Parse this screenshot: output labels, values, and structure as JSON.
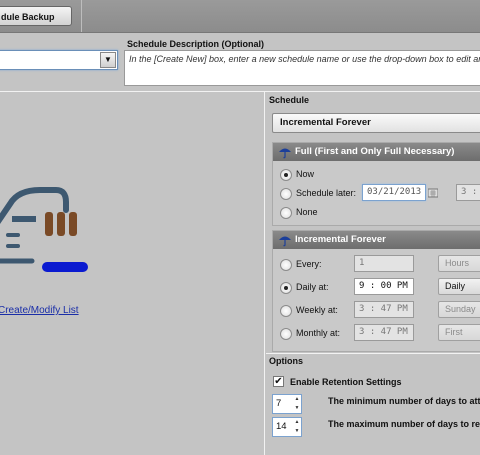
{
  "toolbar": {
    "tab_label": "dule Backup"
  },
  "schedule_name": {
    "value": ""
  },
  "description": {
    "label": "Schedule Description (Optional)",
    "placeholder": "In the [Create New] box, enter a new schedule name or use the drop-down box to edit an exi"
  },
  "left": {
    "link": "Create/Modify List"
  },
  "schedule": {
    "label": "Schedule",
    "type_selected": "Incremental Forever",
    "full": {
      "title": "Full (First and Only Full Necessary)",
      "options": [
        "Now",
        "Schedule later:",
        "None"
      ],
      "selected": "Now",
      "date": "03/21/2013",
      "time": "3 :"
    },
    "incremental": {
      "title": "Incremental Forever",
      "rows": [
        {
          "label": "Every:",
          "value": "1",
          "unit": "Hours"
        },
        {
          "label": "Daily at:",
          "value": "9 : 00 PM",
          "unit": "Daily"
        },
        {
          "label": "Weekly at:",
          "value": "3 : 47 PM",
          "unit": "Sunday"
        },
        {
          "label": "Monthly at:",
          "value": "3 : 47 PM",
          "unit": "First"
        }
      ],
      "selected": "Daily at:"
    }
  },
  "options": {
    "label": "Options",
    "retention_label": "Enable Retention Settings",
    "retention_checked": true,
    "min_days": {
      "value": "7",
      "text": "The minimum number of days to attemp"
    },
    "max_days": {
      "value": "14",
      "text": "The maximum number of days to retain"
    }
  },
  "colors": {
    "accent_blue": "#1a2ea8",
    "group_header": "#7a7a7a",
    "illustration_blue": "#0a1ad0",
    "illustration_brown": "#7a4a26",
    "illustration_navy": "#3d5870"
  }
}
